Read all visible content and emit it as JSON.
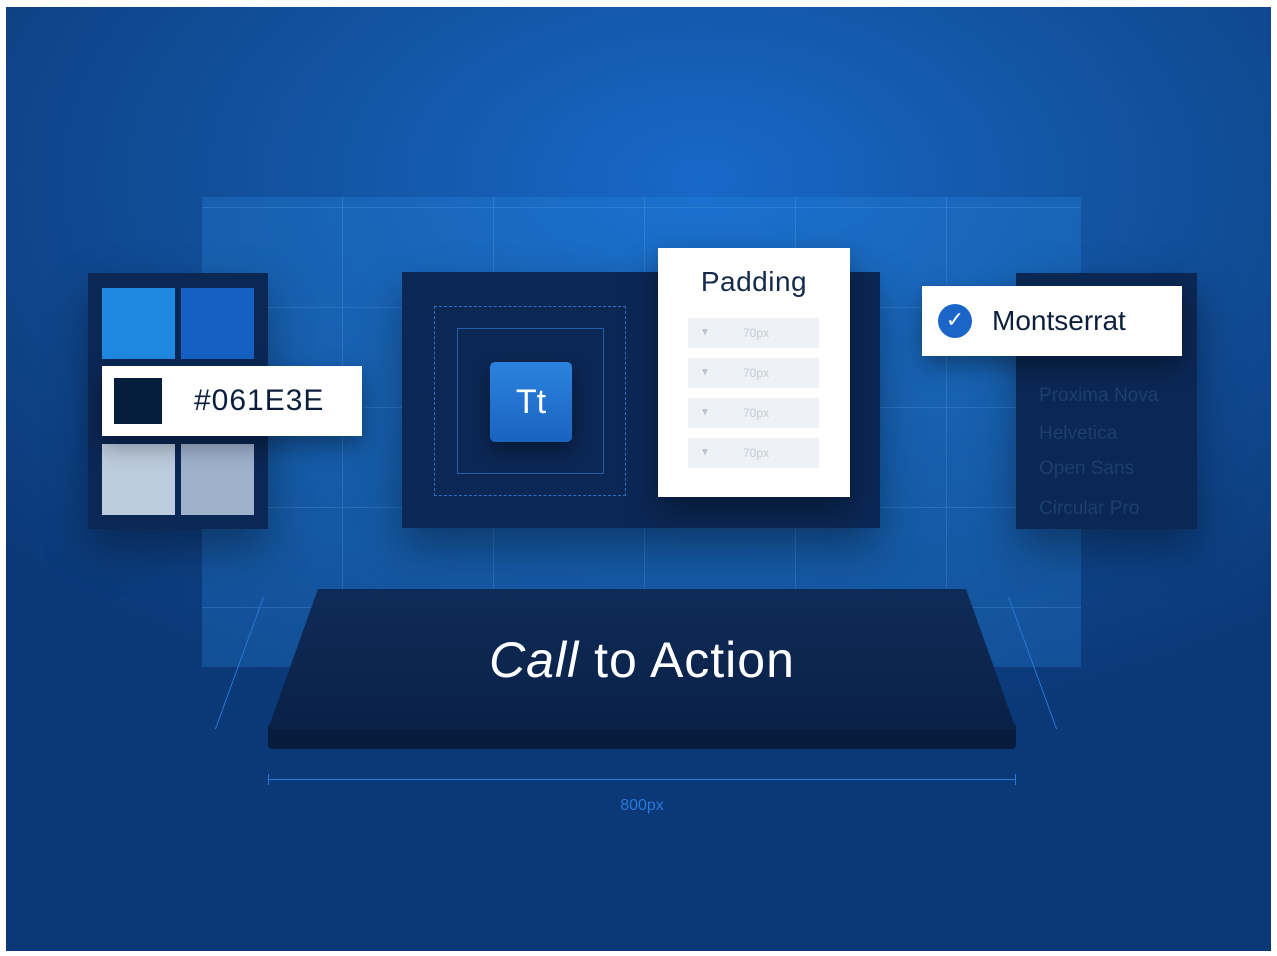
{
  "palette": {
    "swatches": [
      "#1f88e0",
      "#1560c3",
      "#bccbde",
      "#9eb1cd"
    ],
    "selected_color": "#061E3E",
    "selected_chip_color": "#061e3e"
  },
  "typography": {
    "tt_label": "Tt"
  },
  "padding": {
    "title": "Padding",
    "rows": [
      "70px",
      "70px",
      "70px",
      "70px"
    ]
  },
  "fonts": {
    "selected": "Montserrat",
    "options": [
      "Proxima Nova",
      "Helvetica",
      "Open Sans",
      "Circular Pro"
    ]
  },
  "cta": {
    "label_italic": "Call",
    "label_rest": " to Action",
    "width_label": "800px"
  },
  "colors": {
    "accent": "#1c65c8",
    "background": "#12529f",
    "panel": "#0b2754"
  },
  "icons": {
    "check": "check-circle-icon",
    "dropdown": "triangle-down-icon"
  }
}
